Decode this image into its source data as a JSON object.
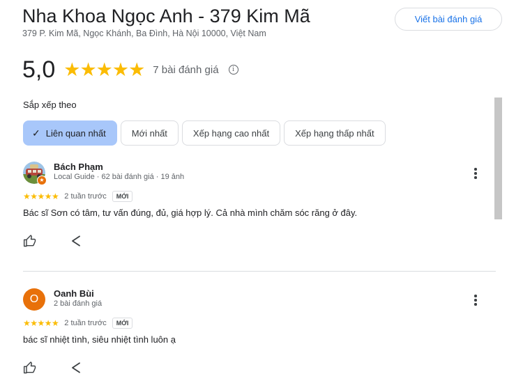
{
  "place": {
    "title": "Nha Khoa Ngọc Anh - 379 Kim Mã",
    "address": "379 P. Kim Mã, Ngọc Khánh, Ba Đình, Hà Nội 10000, Việt Nam",
    "write_review_label": "Viết bài đánh giá"
  },
  "summary": {
    "rating": "5,0",
    "stars": "★★★★★",
    "star_value": 5,
    "review_count": "7 bài đánh giá",
    "info_icon": "i"
  },
  "sort": {
    "label": "Sắp xếp theo",
    "options": [
      {
        "label": "Liên quan nhất",
        "selected": true
      },
      {
        "label": "Mới nhất",
        "selected": false
      },
      {
        "label": "Xếp hạng cao nhất",
        "selected": false
      },
      {
        "label": "Xếp hạng thấp nhất",
        "selected": false
      }
    ]
  },
  "reviews": [
    {
      "name": "Bách Phạm",
      "meta": "Local Guide · 62 bài đánh giá · 19 ảnh",
      "stars": "★★★★★",
      "rating": 5,
      "time": "2 tuần trước",
      "badge": "MỚI",
      "text": "Bác sĩ Sơn có tâm, tư vấn đúng, đủ, giá hợp lý. Cả nhà mình chăm sóc răng ở đây.",
      "avatar": "photo-avatar",
      "local_guide_badge": "★"
    },
    {
      "name": "Oanh Bùi",
      "meta": "2 bài đánh giá",
      "stars": "★★★★★",
      "rating": 5,
      "time": "2 tuần trước",
      "badge": "MỚI",
      "text": "bác sĩ nhiệt tình, siêu nhiệt tình luôn ạ",
      "avatar": "O"
    }
  ],
  "colors": {
    "star": "#fbbc04",
    "accent_blue": "#1a73e8",
    "selected_chip": "#a8c7fa",
    "avatar_orange": "#e8710a"
  },
  "icons": {
    "check": "✓",
    "like": "thumbs-up-icon",
    "share": "share-icon",
    "more": "more-vert-icon"
  }
}
